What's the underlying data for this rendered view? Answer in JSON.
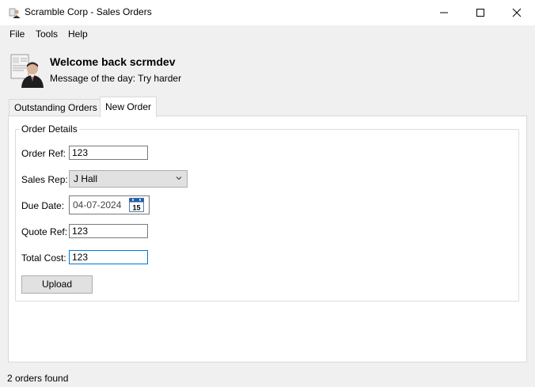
{
  "window": {
    "title": "Scramble Corp - Sales Orders"
  },
  "menu": {
    "items": [
      "File",
      "Tools",
      "Help"
    ]
  },
  "header": {
    "welcome": "Welcome back scrmdev",
    "motd": "Message of the day: Try harder"
  },
  "tabs": [
    {
      "label": "Outstanding Orders",
      "active": false
    },
    {
      "label": "New Order",
      "active": true
    }
  ],
  "order_details": {
    "legend": "Order Details",
    "order_ref": {
      "label": "Order Ref:",
      "value": "123"
    },
    "sales_rep": {
      "label": "Sales Rep:",
      "value": "J Hall"
    },
    "due_date": {
      "label": "Due Date:",
      "value": "04-07-2024",
      "calendar_day": "15"
    },
    "quote_ref": {
      "label": "Quote Ref:",
      "value": "123"
    },
    "total_cost": {
      "label": "Total Cost:",
      "value": "123"
    },
    "upload_label": "Upload"
  },
  "status": {
    "text": "2 orders found"
  },
  "colors": {
    "focus_border": "#0078d7",
    "calendar_accent": "#1f5fa8"
  }
}
